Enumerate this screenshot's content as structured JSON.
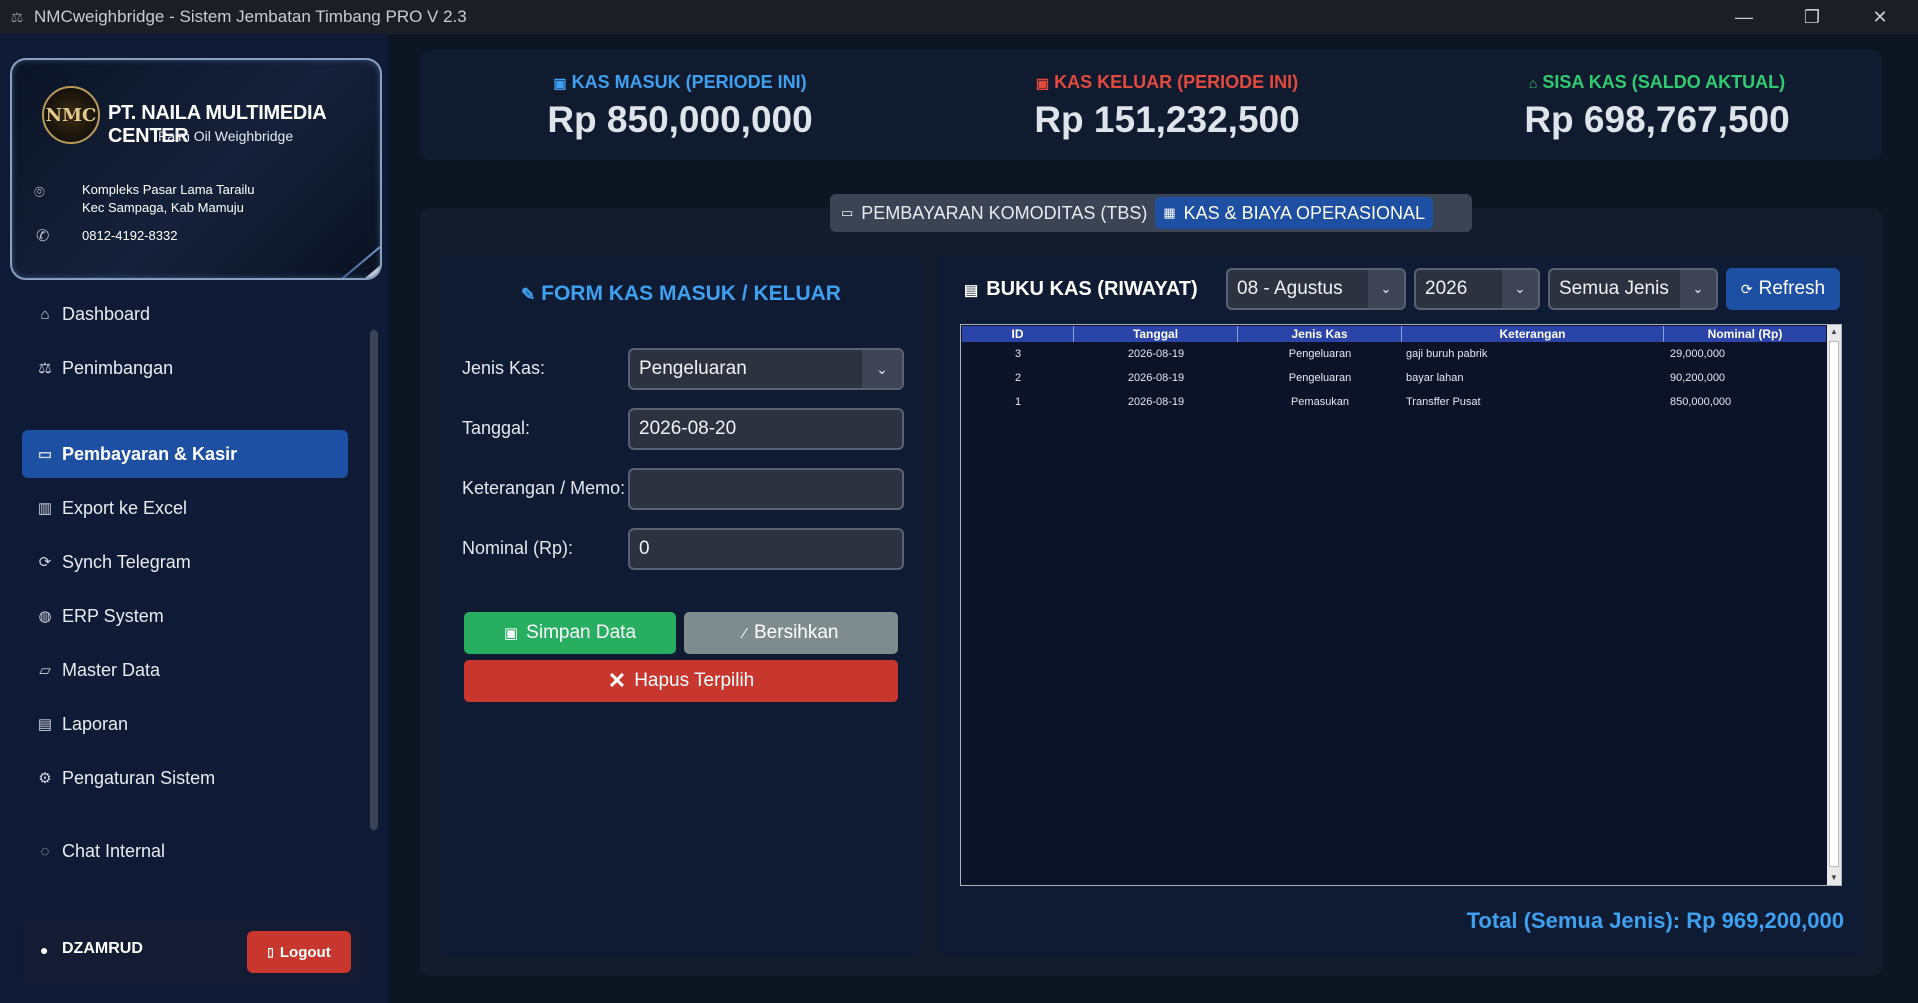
{
  "window": {
    "title": "NMCweighbridge - Sistem Jembatan Timbang PRO V 2.3"
  },
  "company": {
    "logo_text": "NMC",
    "name": "PT. NAILA MULTIMEDIA CENTER",
    "subtitle": "Palm Oil Weighbridge",
    "address_line1": "Kompleks Pasar Lama Tarailu",
    "address_line2": "Kec Sampaga, Kab Mamuju",
    "phone": "0812-4192-8332"
  },
  "sidebar": {
    "items": [
      {
        "label": "Dashboard",
        "icon": "home-icon"
      },
      {
        "label": "Penimbangan",
        "icon": "scale-icon"
      },
      {
        "label": "Pembayaran & Kasir",
        "icon": "payment-card-icon",
        "active": true
      },
      {
        "label": "Export ke Excel",
        "icon": "chart-icon"
      },
      {
        "label": "Synch Telegram",
        "icon": "sync-icon"
      },
      {
        "label": "ERP System",
        "icon": "globe-icon"
      },
      {
        "label": "Master Data",
        "icon": "folder-icon"
      },
      {
        "label": "Laporan",
        "icon": "document-icon"
      },
      {
        "label": "Pengaturan Sistem",
        "icon": "gear-icon"
      },
      {
        "label": "Chat Internal",
        "icon": "chat-icon"
      }
    ],
    "user": {
      "name": "DZAMRUD"
    },
    "logout_label": "Logout"
  },
  "summary": {
    "kas_masuk": {
      "label": "KAS MASUK (PERIODE INI)",
      "value": "Rp 850,000,000",
      "color": "#3da0f0"
    },
    "kas_keluar": {
      "label": "KAS KELUAR (PERIODE INI)",
      "value": "Rp 151,232,500",
      "color": "#e34a3d"
    },
    "sisa_kas": {
      "label": "SISA KAS (SALDO AKTUAL)",
      "value": "Rp 698,767,500",
      "color": "#2ecc71"
    }
  },
  "tabs": [
    {
      "label": "PEMBAYARAN KOMODITAS (TBS)",
      "active": false
    },
    {
      "label": "KAS & BIAYA OPERASIONAL",
      "active": true
    }
  ],
  "form": {
    "title": "FORM KAS MASUK / KELUAR",
    "jenis_kas_label": "Jenis Kas:",
    "jenis_kas_value": "Pengeluaran",
    "tanggal_label": "Tanggal:",
    "tanggal_value": "2026-08-20",
    "keterangan_label": "Keterangan / Memo:",
    "keterangan_value": "",
    "nominal_label": "Nominal (Rp):",
    "nominal_value": "0",
    "simpan_label": "Simpan Data",
    "bersihkan_label": "Bersihkan",
    "hapus_label": "Hapus Terpilih"
  },
  "ledger": {
    "title": "BUKU KAS (RIWAYAT)",
    "month_filter": "08 - Agustus",
    "year_filter": "2026",
    "type_filter": "Semua Jenis",
    "refresh_label": "Refresh",
    "columns": [
      "ID",
      "Tanggal",
      "Jenis Kas",
      "Keterangan",
      "Nominal (Rp)"
    ],
    "rows": [
      {
        "id": "3",
        "tanggal": "2026-08-19",
        "jenis": "Pengeluaran",
        "keterangan": "gaji buruh pabrik",
        "nominal": "29,000,000"
      },
      {
        "id": "2",
        "tanggal": "2026-08-19",
        "jenis": "Pengeluaran",
        "keterangan": "bayar lahan",
        "nominal": "90,200,000"
      },
      {
        "id": "1",
        "tanggal": "2026-08-19",
        "jenis": "Pemasukan",
        "keterangan": "Transffer Pusat",
        "nominal": "850,000,000"
      }
    ],
    "total_label": "Total (Semua Jenis): Rp 969,200,000"
  }
}
